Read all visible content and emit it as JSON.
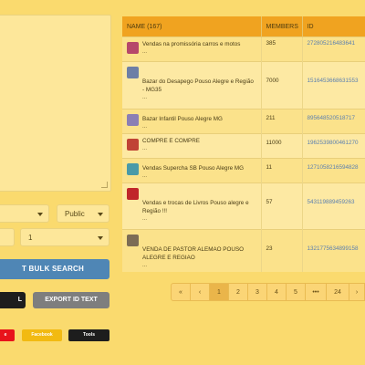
{
  "form": {
    "visibility_select": "Public",
    "number_select": "1",
    "bulk_search_button": "T BULK SEARCH",
    "dark_button": "L",
    "export_button": "EXPORT ID TEXT",
    "small_buttons": [
      {
        "label": "e",
        "color": "#e8131b"
      },
      {
        "label": "Facebook",
        "color": "#f2ba12"
      },
      {
        "label": "Tools",
        "color": "#1d1d1d"
      }
    ]
  },
  "table": {
    "headers": {
      "name": "NAME (167)",
      "members": "MEMBERS",
      "id": "ID"
    },
    "rows": [
      {
        "name": "Vendas na promissória carros e motos",
        "dots": "...",
        "members": "385",
        "id": "272805216483641",
        "thumb_color": "#b6486a"
      },
      {
        "name": "Bazar do Desapego Pouso Alegre e Região - MG35",
        "dots": "...",
        "members": "7000",
        "id": "1516453668631553",
        "thumb_color": "#6d7fa6"
      },
      {
        "name": "Bazar Infantil Pouso Alegre MG",
        "dots": "...",
        "members": "211",
        "id": "895648520518717",
        "thumb_color": "#8b7fb4"
      },
      {
        "name": "COMPRE E COMPRE",
        "dots": "...",
        "members": "11000",
        "id": "1962539800461270",
        "thumb_color": "#c04335"
      },
      {
        "name": "Vendas Supercha SB Pouso Alegre MG",
        "dots": "...",
        "members": "11",
        "id": "1271058216594828",
        "thumb_color": "#4a9aa8"
      },
      {
        "name": "Vendas e trocas de Livros Pouso alegre e Região !!!",
        "dots": "...",
        "members": "57",
        "id": "543119889459263",
        "thumb_color": "#c0262a"
      },
      {
        "name": "VENDA DE PASTOR ALEMAO POUSO ALEGRE E REGIAO",
        "dots": "...",
        "members": "23",
        "id": "1321775634899158",
        "thumb_color": "#7c6c55"
      }
    ]
  },
  "pagination": {
    "items": [
      "«",
      "‹",
      "1",
      "2",
      "3",
      "4",
      "5",
      "•••",
      "24",
      "›"
    ]
  }
}
